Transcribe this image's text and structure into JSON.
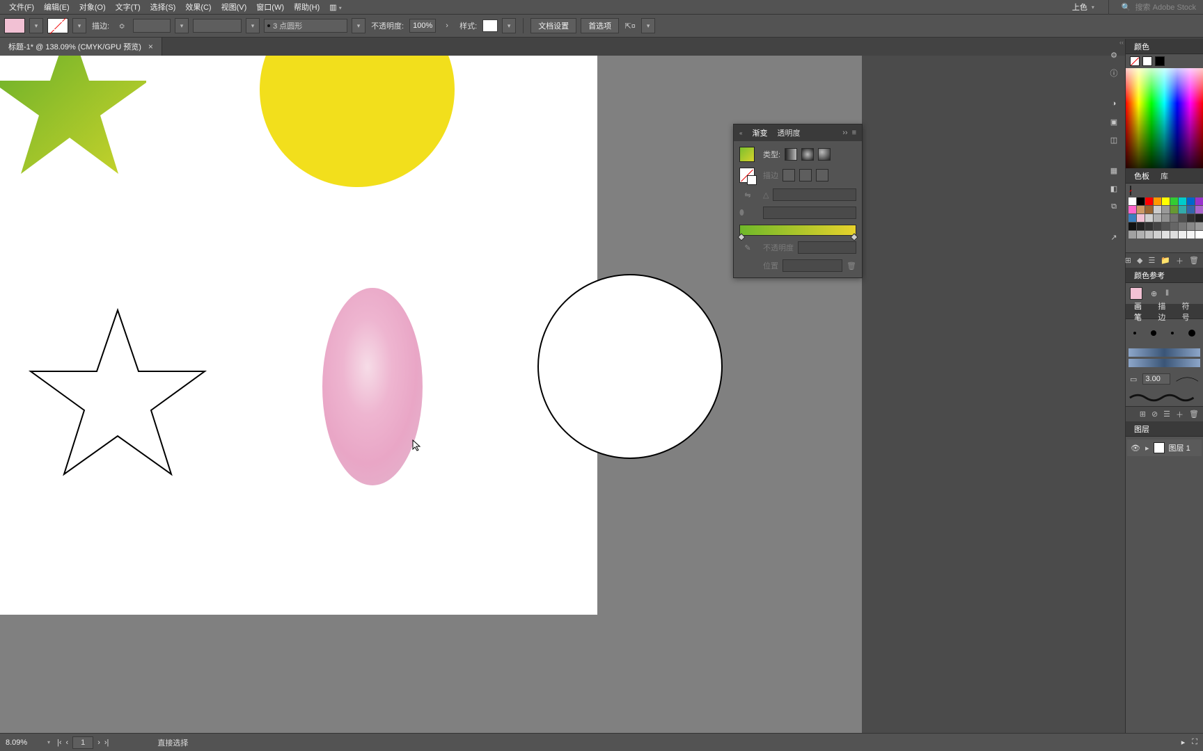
{
  "menu": {
    "file": "文件(F)",
    "edit": "编辑(E)",
    "object": "对象(O)",
    "type": "文字(T)",
    "select": "选择(S)",
    "effect": "效果(C)",
    "view": "视图(V)",
    "window": "窗口(W)",
    "help": "帮助(H)"
  },
  "topright": {
    "arrange": "上色",
    "search_placeholder": "搜索 Adobe Stock"
  },
  "options": {
    "stroke_label": "描边:",
    "stroke_weight": "",
    "profile_label": "3 点圆形",
    "opacity_label": "不透明度:",
    "opacity_value": "100%",
    "style_label": "样式:",
    "doc_setup": "文档设置",
    "prefs": "首选项"
  },
  "tab": {
    "title": "标题-1* @ 138.09% (CMYK/GPU 预览)"
  },
  "gradient": {
    "tab_gradient": "渐变",
    "tab_transparency": "透明度",
    "type_label": "类型:",
    "stroke_label": "描边",
    "angle_label": "△",
    "pos_label": "位置",
    "opacity_label": "不透明度"
  },
  "panels": {
    "color": "颜色",
    "swatches": "色板",
    "libraries": "库",
    "color_guide": "颜色参考",
    "brushes": "画笔",
    "stroke": "描边",
    "symbols": "符号",
    "stroke_weight": "3.00",
    "layers": "图层",
    "layer1": "图层 1"
  },
  "swatch_colors": [
    "#ffffff",
    "#000000",
    "#ff0000",
    "#ff9900",
    "#ffff00",
    "#33cc33",
    "#00cccc",
    "#0066cc",
    "#9933cc",
    "#ff66cc",
    "#cc9966",
    "#996633",
    "#cccccc",
    "#999999",
    "#669933",
    "#33aaaa",
    "#3366aa",
    "#aa66cc",
    "#3a7fbf",
    "#f2c1d4",
    "#d0d0d0",
    "#b0b0b0",
    "#909090",
    "#707070",
    "#505050",
    "#303030",
    "#202020",
    "#111111",
    "#222222",
    "#333333",
    "#444444",
    "#555555",
    "#666666",
    "#777777",
    "#888888",
    "#999999",
    "#a1a1a1",
    "#b1b1b1",
    "#c1c1c1",
    "#d1d1d1",
    "#e1e1e1",
    "#dddddd",
    "#eeeeee",
    "#f5f5f5",
    "#ffffff"
  ],
  "status": {
    "zoom": "8.09%",
    "page": "1",
    "tool": "直接选择"
  }
}
